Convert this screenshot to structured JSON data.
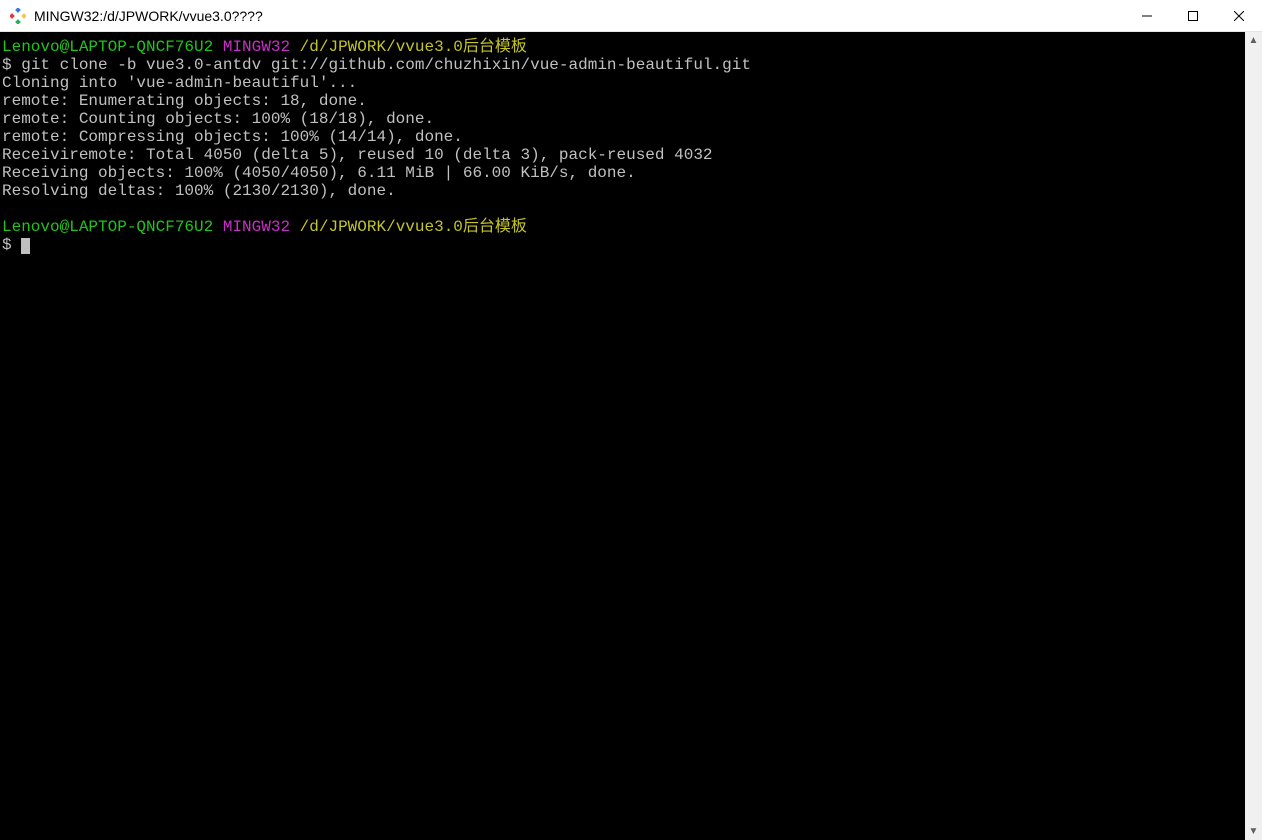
{
  "window": {
    "title": "MINGW32:/d/JPWORK/vvue3.0????"
  },
  "prompt": {
    "user_host": "Lenovo@LAPTOP-QNCF76U2",
    "shell": "MINGW32",
    "cwd": "/d/JPWORK/vvue3.0后台模板",
    "ps1": "$"
  },
  "command": "git clone -b vue3.0-antdv git://github.com/chuzhixin/vue-admin-beautiful.git",
  "output_lines": [
    "Cloning into 'vue-admin-beautiful'...",
    "remote: Enumerating objects: 18, done.",
    "remote: Counting objects: 100% (18/18), done.",
    "remote: Compressing objects: 100% (14/14), done.",
    "Receiviremote: Total 4050 (delta 5), reused 10 (delta 3), pack-reused 4032",
    "Receiving objects: 100% (4050/4050), 6.11 MiB | 66.00 KiB/s, done.",
    "Resolving deltas: 100% (2130/2130), done."
  ]
}
